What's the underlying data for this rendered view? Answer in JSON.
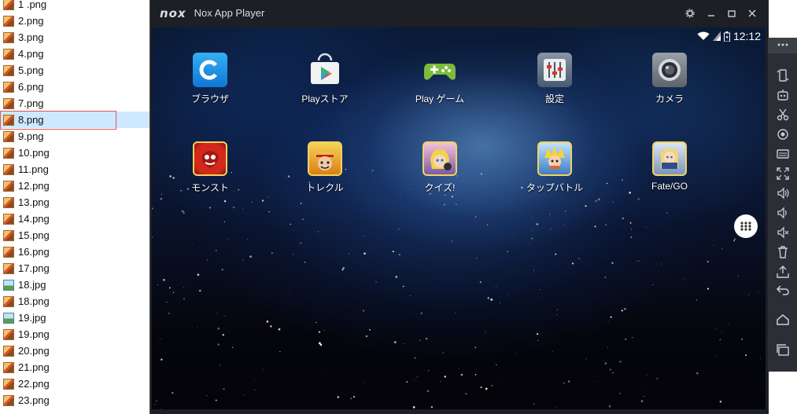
{
  "file_list": [
    {
      "name": "1 .png",
      "type": "png"
    },
    {
      "name": "2.png",
      "type": "png"
    },
    {
      "name": "3.png",
      "type": "png"
    },
    {
      "name": "4.png",
      "type": "png"
    },
    {
      "name": "5.png",
      "type": "png"
    },
    {
      "name": "6.png",
      "type": "png"
    },
    {
      "name": "7.png",
      "type": "png"
    },
    {
      "name": "8.png",
      "type": "png",
      "selected": true
    },
    {
      "name": "9.png",
      "type": "png"
    },
    {
      "name": "10.png",
      "type": "png"
    },
    {
      "name": "11.png",
      "type": "png"
    },
    {
      "name": "12.png",
      "type": "png"
    },
    {
      "name": "13.png",
      "type": "png"
    },
    {
      "name": "14.png",
      "type": "png"
    },
    {
      "name": "15.png",
      "type": "png"
    },
    {
      "name": "16.png",
      "type": "png"
    },
    {
      "name": "17.png",
      "type": "png"
    },
    {
      "name": "18.jpg",
      "type": "jpg"
    },
    {
      "name": "18.png",
      "type": "png"
    },
    {
      "name": "19.jpg",
      "type": "jpg"
    },
    {
      "name": "19.png",
      "type": "png"
    },
    {
      "name": "20.png",
      "type": "png"
    },
    {
      "name": "21.png",
      "type": "png"
    },
    {
      "name": "22.png",
      "type": "png"
    },
    {
      "name": "23.png",
      "type": "png"
    }
  ],
  "window": {
    "logo": "nox",
    "title": "Nox App Player",
    "buttons": [
      "gear-icon",
      "minimize-icon",
      "maximize-icon",
      "close-icon"
    ]
  },
  "status_bar": {
    "time": "12:12",
    "icons": [
      "wifi-icon",
      "signal-icon",
      "battery-icon"
    ]
  },
  "apps": [
    {
      "label": "ブラウザ",
      "icon": "browser-icon",
      "color": "#1a8fe3"
    },
    {
      "label": "Playストア",
      "icon": "play-store-icon",
      "color": "#eeeeee"
    },
    {
      "label": "Play ゲーム",
      "icon": "play-games-icon",
      "color": "#7dbb3c"
    },
    {
      "label": "設定",
      "icon": "settings-icon",
      "color": "#5a6f86"
    },
    {
      "label": "カメラ",
      "icon": "camera-icon",
      "color": "#7a7f87"
    },
    {
      "label": "モンスト",
      "icon": "monst-icon",
      "color": "#c8231a"
    },
    {
      "label": "トレクル",
      "icon": "trecru-icon",
      "color": "#e09a20"
    },
    {
      "label": "クイズ!",
      "icon": "quiz-icon",
      "color": "#e86aa0"
    },
    {
      "label": "タップバトル",
      "icon": "tap-battle-icon",
      "color": "#f0b52a"
    },
    {
      "label": "Fate/GO",
      "icon": "fate-go-icon",
      "color": "#3a5fa0"
    }
  ],
  "sidebar_icons": [
    "more-icon",
    "phone-rotate-icon",
    "robot-icon",
    "scissors-icon",
    "location-icon",
    "keyboard-icon",
    "fullscreen-icon",
    "volume-up-icon",
    "volume-down-icon",
    "mute-icon",
    "trash-icon",
    "install-apk-icon",
    "back-icon",
    "home-icon",
    "recent-apps-icon"
  ]
}
